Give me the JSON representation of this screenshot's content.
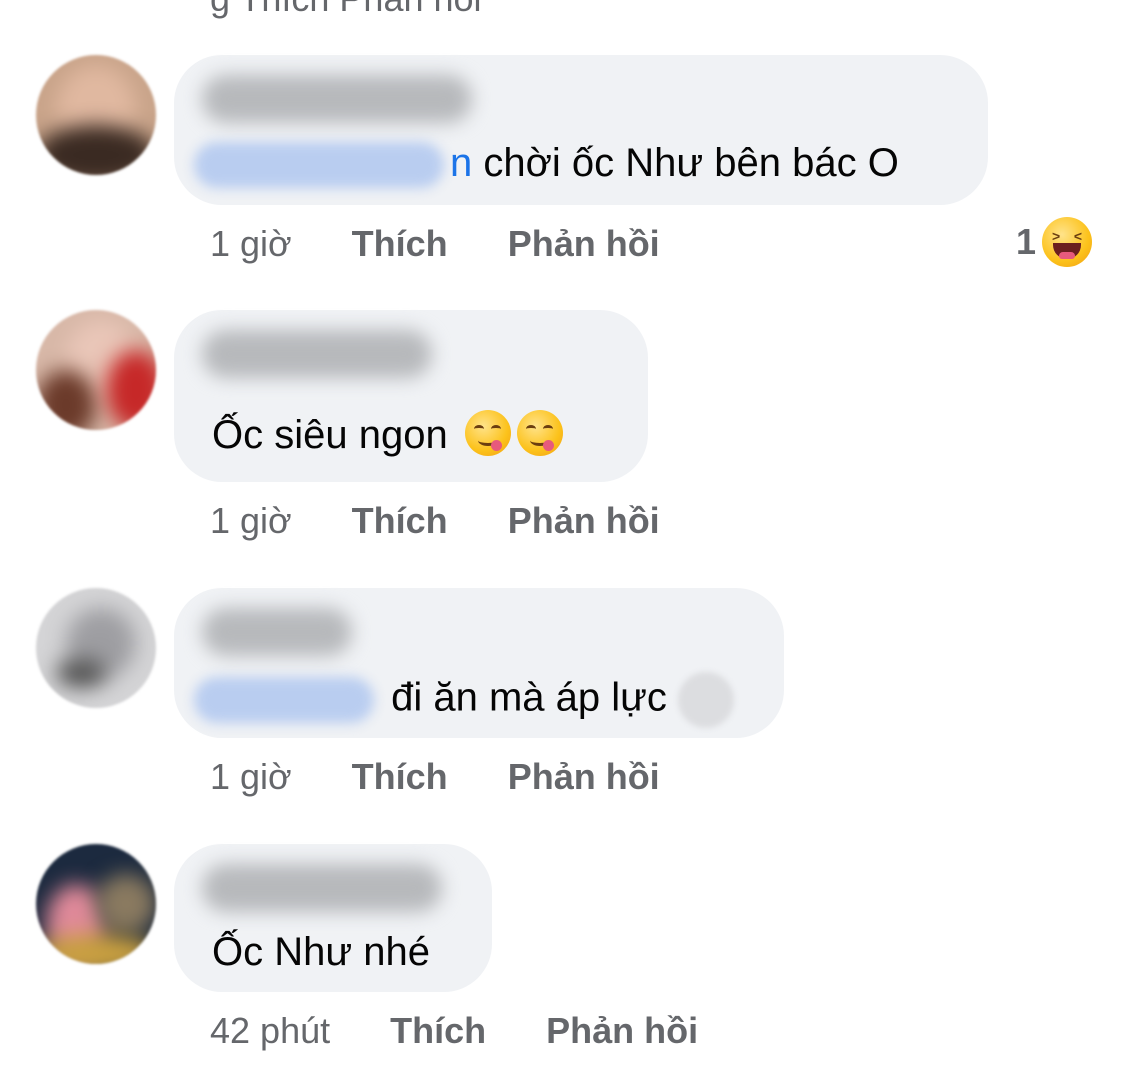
{
  "top_partial": {
    "text": "g                Thích        Phản hồi"
  },
  "comments": [
    {
      "text": "chời ốc Như bên bác O",
      "mention_tail": "n",
      "time": "1 giờ",
      "like_label": "Thích",
      "reply_label": "Phản hồi",
      "reaction_count": "1",
      "reaction_icon": "laughing-emoji"
    },
    {
      "text": "Ốc siêu ngon",
      "emojis": [
        "yum-emoji",
        "yum-emoji"
      ],
      "time": "1 giờ",
      "like_label": "Thích",
      "reply_label": "Phản hồi"
    },
    {
      "text": "đi ăn mà áp lực",
      "time": "1 giờ",
      "like_label": "Thích",
      "reply_label": "Phản hồi"
    },
    {
      "text": "Ốc Như nhé",
      "time": "42 phút",
      "like_label": "Thích",
      "reply_label": "Phản hồi"
    }
  ],
  "colors": {
    "bubble": "#f0f2f5",
    "meta_text": "#65676b",
    "mention_blue": "#1a73e8"
  }
}
